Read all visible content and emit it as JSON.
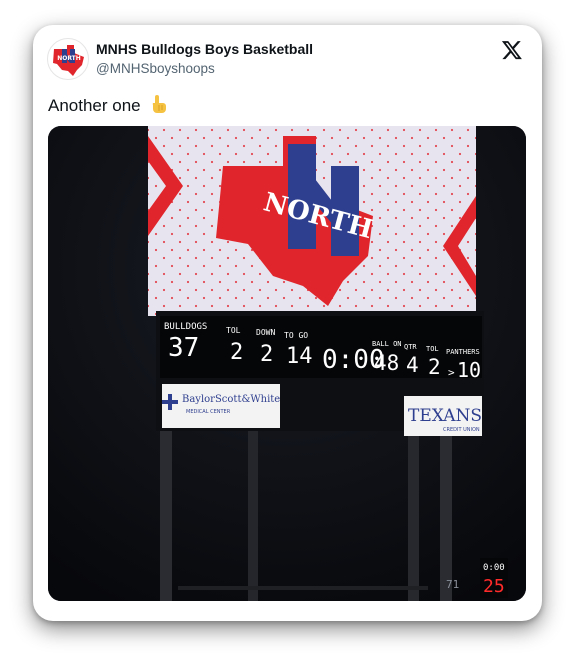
{
  "account": {
    "display_name": "MNHS Bulldogs Boys Basketball",
    "handle": "@MNHSboyshoops",
    "avatar_icon": "north-texas-logo-icon"
  },
  "platform": {
    "logo_icon": "x-logo-icon"
  },
  "tweet": {
    "text": "Another one",
    "emoji_icon": "pointing-up-finger-icon"
  },
  "scoreboard": {
    "video_logo_text": "NORTH",
    "home_label": "BULLDOGS",
    "home_score": "37",
    "tol_label": "TOL",
    "home_tol": "2",
    "down_label": "DOWN",
    "down_value": "2",
    "togo_label": "TO GO",
    "togo_value": "14",
    "clock": "0:00",
    "ballon_label": "BALL ON",
    "ballon_value": "48",
    "qtr_label": "QTR",
    "qtr_value": "4",
    "away_tol_label": "TOL",
    "away_tol": "2",
    "away_label": "PANTHERS",
    "possession_arrow": ">",
    "away_score": "10",
    "sponsor_left_line1": "BaylorScott&White",
    "sponsor_left_line2": "MEDICAL CENTER",
    "sponsor_right_line1": "TEXANS",
    "sponsor_right_line2": "CREDIT UNION",
    "play_clock_top": "0:00",
    "play_clock_bottom": "25",
    "side_digits": "71"
  },
  "colors": {
    "brand_red": "#e0262c",
    "brand_blue": "#2f3f8f",
    "led_text": "#ffffff",
    "text_primary": "#0f1419",
    "text_secondary": "#536471"
  }
}
